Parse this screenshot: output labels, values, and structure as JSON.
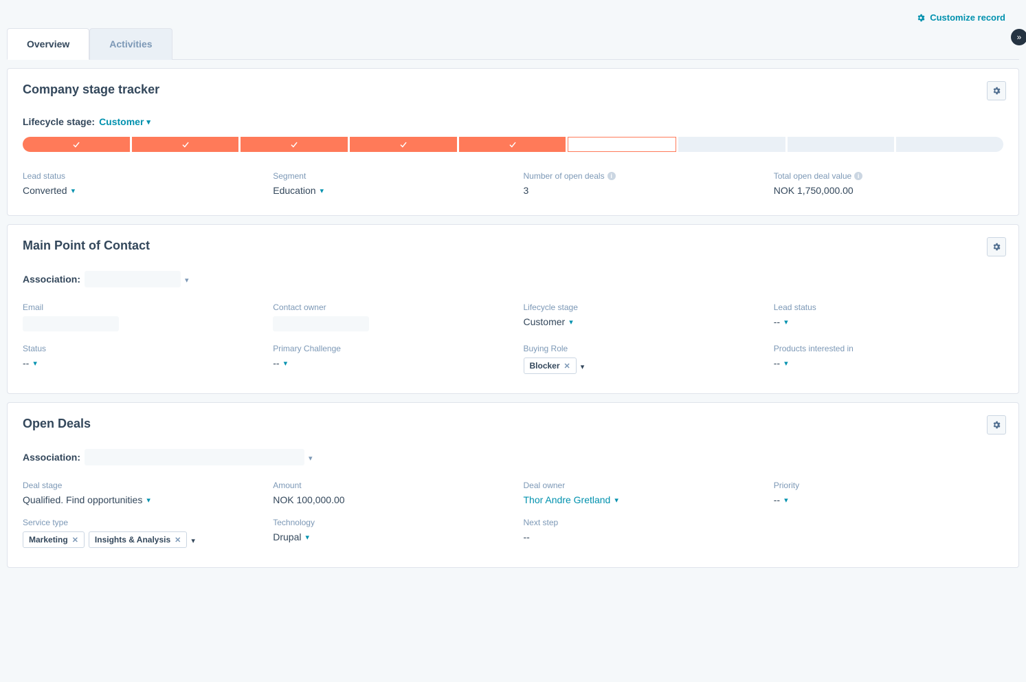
{
  "header": {
    "customize_label": "Customize record"
  },
  "tabs": [
    {
      "label": "Overview",
      "active": true
    },
    {
      "label": "Activities",
      "active": false
    }
  ],
  "card1": {
    "title": "Company stage tracker",
    "lifecycle_label": "Lifecycle stage:",
    "lifecycle_value": "Customer",
    "fields": {
      "lead_status": {
        "label": "Lead status",
        "value": "Converted"
      },
      "segment": {
        "label": "Segment",
        "value": "Education"
      },
      "open_deals": {
        "label": "Number of open deals",
        "value": "3"
      },
      "total_value": {
        "label": "Total open deal value",
        "value": "NOK 1,750,000.00"
      }
    }
  },
  "card2": {
    "title": "Main Point of Contact",
    "association_label": "Association:",
    "fields": {
      "email": {
        "label": "Email"
      },
      "contact_owner": {
        "label": "Contact owner"
      },
      "lifecycle": {
        "label": "Lifecycle stage",
        "value": "Customer"
      },
      "lead_status": {
        "label": "Lead status",
        "value": "--"
      },
      "status": {
        "label": "Status",
        "value": "--"
      },
      "primary_challenge": {
        "label": "Primary Challenge",
        "value": "--"
      },
      "buying_role": {
        "label": "Buying Role",
        "tags": [
          "Blocker"
        ]
      },
      "products": {
        "label": "Products interested in",
        "value": "--"
      }
    }
  },
  "card3": {
    "title": "Open Deals",
    "association_label": "Association:",
    "fields": {
      "deal_stage": {
        "label": "Deal stage",
        "value": "Qualified. Find opportunities"
      },
      "amount": {
        "label": "Amount",
        "value": "NOK 100,000.00"
      },
      "deal_owner": {
        "label": "Deal owner",
        "value": "Thor Andre Gretland"
      },
      "priority": {
        "label": "Priority",
        "value": "--"
      },
      "service_type": {
        "label": "Service type",
        "tags": [
          "Marketing",
          "Insights & Analysis"
        ]
      },
      "technology": {
        "label": "Technology",
        "value": "Drupal"
      },
      "next_step": {
        "label": "Next step",
        "value": "--"
      }
    }
  }
}
